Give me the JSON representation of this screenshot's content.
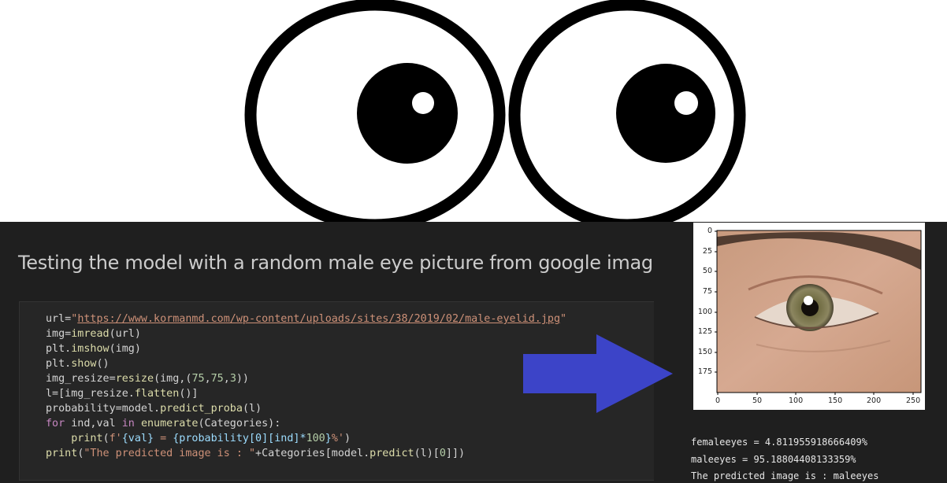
{
  "title": "Testing the model with a random male eye picture from google images",
  "code_lines": [
    "url=\"https://www.kormanmd.com/wp-content/uploads/sites/38/2019/02/male-eyelid.jpg\"",
    "img=imread(url)",
    "plt.imshow(img)",
    "plt.show()",
    "img_resize=resize(img,(75,75,3))",
    "l=[img_resize.flatten()]",
    "probability=model.predict_proba(l)",
    "for ind,val in enumerate(Categories):",
    "    print(f'{val} = {probability[0][ind]*100}%')",
    "print(\"The predicted image is : \"+Categories[model.predict(l)[0]])"
  ],
  "url_text": "https://www.kormanmd.com/wp-content/uploads/sites/38/2019/02/male-eyelid.jpg",
  "plot": {
    "y_ticks": [
      "0",
      "25",
      "50",
      "75",
      "100",
      "125",
      "150",
      "175"
    ],
    "x_ticks": [
      "0",
      "50",
      "100",
      "150",
      "200",
      "250"
    ]
  },
  "output": {
    "line1": "femaleeyes = 4.811955918666409%",
    "line2": "maleeyes = 95.18804408133359%",
    "line3": "The predicted image is : maleeyes"
  },
  "colors": {
    "panel_bg": "#1f1f1f",
    "arrow": "#3c44c8"
  },
  "icons": {
    "cartoon": "cartoon-eyes-icon",
    "arrow": "arrow-right-icon"
  }
}
